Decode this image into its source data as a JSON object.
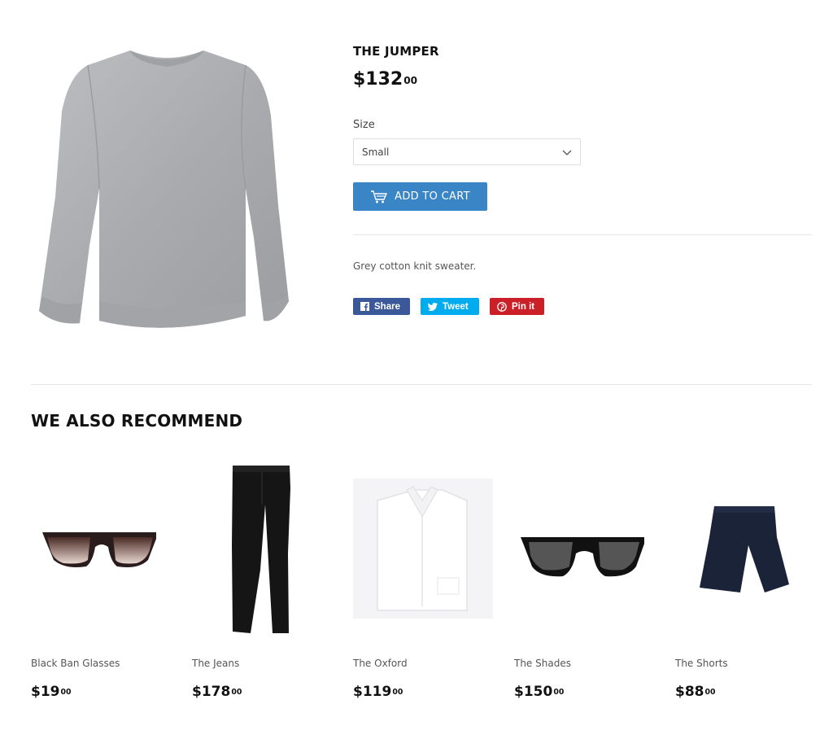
{
  "product": {
    "title": "THE JUMPER",
    "price_main": "$132",
    "price_cents": "00",
    "size_label": "Size",
    "size_selected": "Small",
    "add_to_cart": "ADD TO CART",
    "description": "Grey cotton knit sweater.",
    "icon": "sweater-image"
  },
  "share": {
    "facebook": "Share",
    "twitter": "Tweet",
    "pinterest": "Pin it",
    "colors": {
      "facebook": "#3b5998",
      "twitter": "#00aced",
      "pinterest": "#cb2027"
    }
  },
  "accent_color": "#3a85c6",
  "recommend": {
    "heading": "WE ALSO RECOMMEND",
    "items": [
      {
        "name": "Black Ban Glasses",
        "price_main": "$19",
        "price_cents": "00",
        "image": "brown-sunglasses-image"
      },
      {
        "name": "The Jeans",
        "price_main": "$178",
        "price_cents": "00",
        "image": "black-jeans-image"
      },
      {
        "name": "The Oxford",
        "price_main": "$119",
        "price_cents": "00",
        "image": "white-shirt-image"
      },
      {
        "name": "The Shades",
        "price_main": "$150",
        "price_cents": "00",
        "image": "black-sunglasses-image"
      },
      {
        "name": "The Shorts",
        "price_main": "$88",
        "price_cents": "00",
        "image": "navy-shorts-image"
      }
    ]
  }
}
